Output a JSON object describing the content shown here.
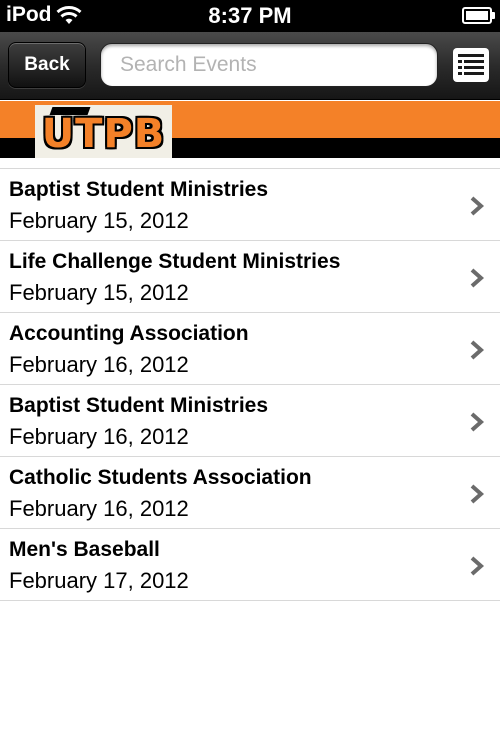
{
  "status_bar": {
    "carrier": "iPod",
    "time": "8:37 PM",
    "battery_level": 1.0
  },
  "nav": {
    "back_label": "Back",
    "search_placeholder": "Search Events",
    "list_icon": "list-icon"
  },
  "banner": {
    "logo_text": "UTPB",
    "colors": {
      "orange": "#f48128",
      "black": "#000000"
    }
  },
  "events": [
    {
      "title": "Baptist Student Ministries",
      "date": "February 15, 2012"
    },
    {
      "title": "Life Challenge Student Ministries",
      "date": "February 15, 2012"
    },
    {
      "title": "Accounting Association",
      "date": "February 16, 2012"
    },
    {
      "title": "Baptist Student Ministries",
      "date": "February 16, 2012"
    },
    {
      "title": "Catholic Students Association",
      "date": "February 16, 2012"
    },
    {
      "title": "Men's Baseball",
      "date": "February 17, 2012"
    }
  ]
}
